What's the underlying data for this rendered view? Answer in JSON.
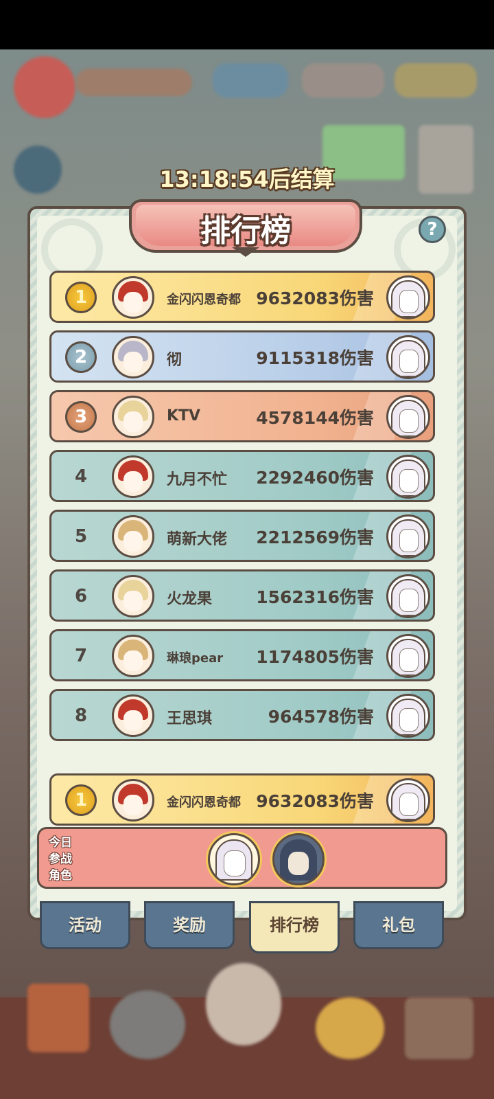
{
  "timer": "13:18:54后结算",
  "title": "排行榜",
  "help_icon": "?",
  "rows": [
    {
      "rank": "1",
      "name": "金闪闪恩奇都",
      "score": "9632083伤害",
      "tier": "gold",
      "hair": "#c0392b"
    },
    {
      "rank": "2",
      "name": "彻",
      "score": "9115318伤害",
      "tier": "silver",
      "hair": "#b9b6c9"
    },
    {
      "rank": "3",
      "name": "KTV",
      "score": "4578144伤害",
      "tier": "bronze",
      "hair": "#e8d39a"
    },
    {
      "rank": "4",
      "name": "九月不忙",
      "score": "2292460伤害",
      "tier": "normal",
      "hair": "#c0392b"
    },
    {
      "rank": "5",
      "name": "萌新大佬",
      "score": "2212569伤害",
      "tier": "normal",
      "hair": "#d9b57a"
    },
    {
      "rank": "6",
      "name": "火龙果",
      "score": "1562316伤害",
      "tier": "normal",
      "hair": "#e8d39a"
    },
    {
      "rank": "7",
      "name": "琳琅pear",
      "score": "1174805伤害",
      "tier": "normal",
      "hair": "#d9b57a"
    },
    {
      "rank": "8",
      "name": "王思琪",
      "score": "964578伤害",
      "tier": "normal",
      "hair": "#c0392b"
    }
  ],
  "my_rank": {
    "rank": "1",
    "name": "金闪闪恩奇都",
    "score": "9632083伤害"
  },
  "today": {
    "label_line1": "今日",
    "label_line2": "参战",
    "label_line3": "角色"
  },
  "tabs": [
    {
      "label": "活动",
      "active": false
    },
    {
      "label": "奖励",
      "active": false
    },
    {
      "label": "排行榜",
      "active": true
    },
    {
      "label": "礼包",
      "active": false
    }
  ]
}
